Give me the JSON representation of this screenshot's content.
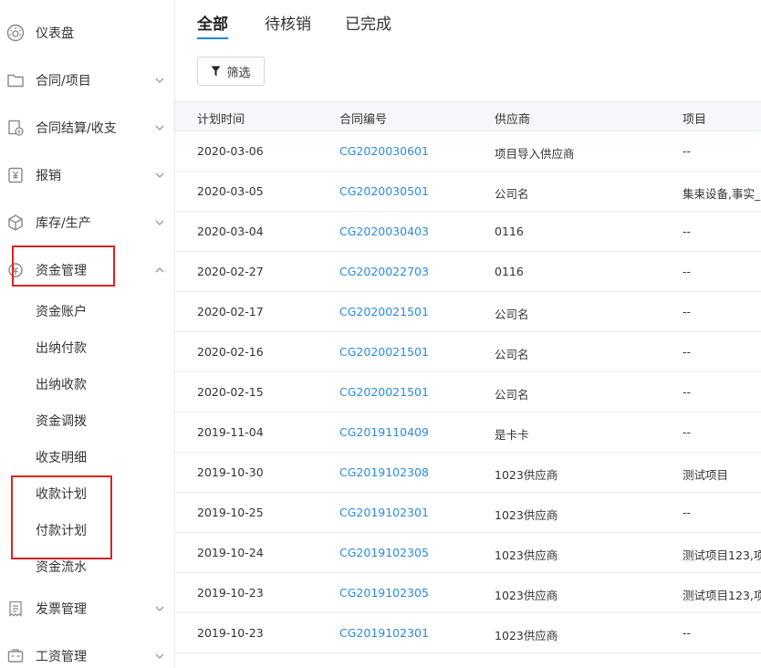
{
  "sidebar": {
    "items": [
      {
        "label": "仪表盘",
        "icon": "dashboard-icon"
      },
      {
        "label": "合同/项目",
        "icon": "folder-icon"
      },
      {
        "label": "合同结算/收支",
        "icon": "settlement-icon"
      },
      {
        "label": "报销",
        "icon": "reimburse-icon"
      },
      {
        "label": "库存/生产",
        "icon": "box-icon"
      },
      {
        "label": "资金管理",
        "icon": "fund-icon"
      },
      {
        "label": "发票管理",
        "icon": "invoice-icon"
      },
      {
        "label": "工资管理",
        "icon": "salary-icon"
      }
    ],
    "fund_sub": [
      {
        "label": "资金账户"
      },
      {
        "label": "出纳付款"
      },
      {
        "label": "出纳收款"
      },
      {
        "label": "资金调拨"
      },
      {
        "label": "收支明细"
      },
      {
        "label": "收款计划"
      },
      {
        "label": "付款计划"
      },
      {
        "label": "资金流水"
      }
    ]
  },
  "tabs": [
    {
      "label": "全部",
      "active": true
    },
    {
      "label": "待核销",
      "active": false
    },
    {
      "label": "已完成",
      "active": false
    }
  ],
  "filter": {
    "label": "筛选"
  },
  "table": {
    "headers": [
      "计划时间",
      "合同编号",
      "供应商",
      "项目"
    ],
    "rows": [
      [
        "2020-03-06",
        "CG2020030601",
        "项目导入供应商",
        "--"
      ],
      [
        "2020-03-05",
        "CG2020030501",
        "公司名",
        "集束设备,事实_"
      ],
      [
        "2020-03-04",
        "CG2020030403",
        "0116",
        "--"
      ],
      [
        "2020-02-27",
        "CG2020022703",
        "0116",
        "--"
      ],
      [
        "2020-02-17",
        "CG2020021501",
        "公司名",
        "--"
      ],
      [
        "2020-02-16",
        "CG2020021501",
        "公司名",
        "--"
      ],
      [
        "2020-02-15",
        "CG2020021501",
        "公司名",
        "--"
      ],
      [
        "2019-11-04",
        "CG2019110409",
        "是卡卡",
        "--"
      ],
      [
        "2019-10-30",
        "CG2019102308",
        "1023供应商",
        "测试项目"
      ],
      [
        "2019-10-25",
        "CG2019102301",
        "1023供应商",
        "--"
      ],
      [
        "2019-10-24",
        "CG2019102305",
        "1023供应商",
        "测试项目123,项"
      ],
      [
        "2019-10-23",
        "CG2019102305",
        "1023供应商",
        "测试项目123,项"
      ],
      [
        "2019-10-23",
        "CG2019102301",
        "1023供应商",
        "--"
      ]
    ]
  },
  "colors": {
    "accent": "#1a8be0",
    "link": "#2c8be0",
    "highlight": "#e02020",
    "header_bg": "#f5f7fa"
  }
}
